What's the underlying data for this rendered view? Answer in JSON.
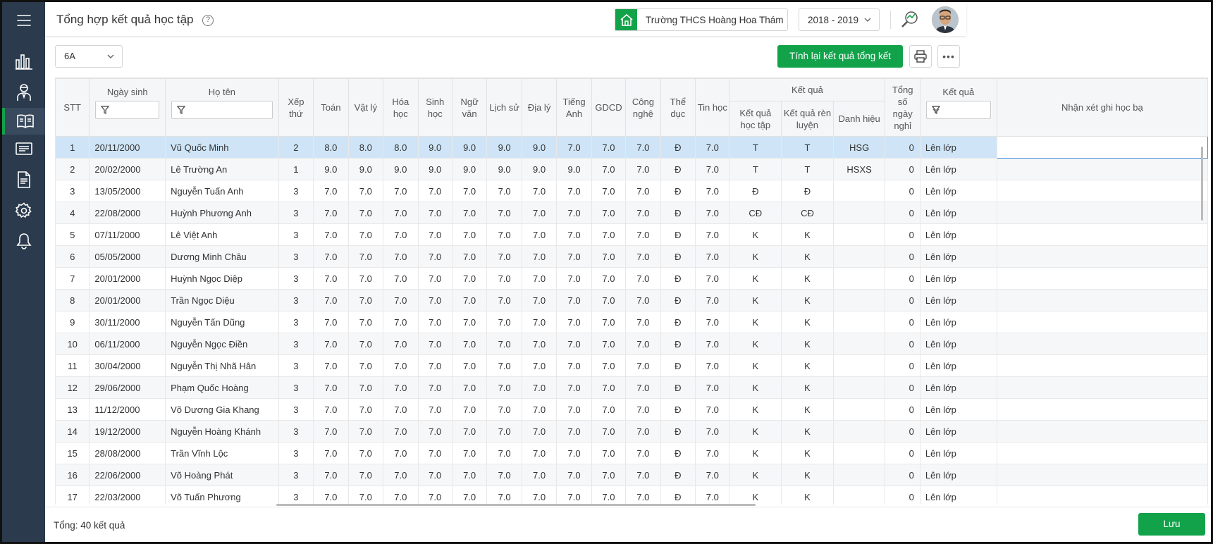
{
  "header": {
    "title": "Tổng hợp kết quả học tập",
    "help_icon": "?",
    "school": "Trường THCS Hoàng Hoa Thám",
    "school_icon": "home-icon",
    "year": "2018 - 2019"
  },
  "sidebar": {
    "items": [
      {
        "name": "menu-icon"
      },
      {
        "name": "bar-chart-icon"
      },
      {
        "name": "teacher-icon"
      },
      {
        "name": "book-icon",
        "active": true
      },
      {
        "name": "id-card-icon"
      },
      {
        "name": "document-icon"
      },
      {
        "name": "gear-icon"
      },
      {
        "name": "bell-icon"
      }
    ]
  },
  "toolbar": {
    "class_value": "6A",
    "recalc_label": "Tính lại kết quả tổng kết",
    "more_label": "•••"
  },
  "table": {
    "headers": {
      "stt": "STT",
      "ngay_sinh": "Ngày sinh",
      "ho_ten": "Họ tên",
      "xep_thu": "Xếp thứ",
      "toan": "Toán",
      "vat_ly": "Vật lý",
      "hoa_hoc": "Hóa học",
      "sinh_hoc": "Sinh học",
      "ngu_van": "Ngữ văn",
      "lich_su": "Lịch sử",
      "dia_ly": "Địa lý",
      "tieng_anh": "Tiếng Anh",
      "gdcd": "GDCD",
      "cong_nghe": "Công nghệ",
      "the_duc": "Thể dục",
      "tin_hoc": "Tin học",
      "ket_qua_group": "Kết quả",
      "kq_hoc_tap": "Kết quả học tập",
      "kq_ren_luyen": "Kết quả rèn luyện",
      "danh_hieu": "Danh hiệu",
      "tong_so_ngay_nghi": "Tổng số ngày nghỉ",
      "ket_qua": "Kết quả",
      "nhan_xet": "Nhận xét ghi học bạ"
    },
    "rows": [
      [
        "1",
        "20/11/2000",
        "Vũ Quốc Minh",
        "2",
        "8.0",
        "8.0",
        "8.0",
        "9.0",
        "9.0",
        "9.0",
        "9.0",
        "7.0",
        "7.0",
        "7.0",
        "Đ",
        "7.0",
        "T",
        "T",
        "HSG",
        "0",
        "Lên lớp"
      ],
      [
        "2",
        "20/02/2000",
        "Lê Trường An",
        "1",
        "9.0",
        "9.0",
        "9.0",
        "9.0",
        "9.0",
        "9.0",
        "9.0",
        "9.0",
        "7.0",
        "7.0",
        "Đ",
        "7.0",
        "T",
        "T",
        "HSXS",
        "0",
        "Lên lớp"
      ],
      [
        "3",
        "13/05/2000",
        "Nguyễn Tuấn Anh",
        "3",
        "7.0",
        "7.0",
        "7.0",
        "7.0",
        "7.0",
        "7.0",
        "7.0",
        "7.0",
        "7.0",
        "7.0",
        "Đ",
        "7.0",
        "Đ",
        "Đ",
        "",
        "0",
        "Lên lớp"
      ],
      [
        "4",
        "22/08/2000",
        "Huỳnh Phương Anh",
        "3",
        "7.0",
        "7.0",
        "7.0",
        "7.0",
        "7.0",
        "7.0",
        "7.0",
        "7.0",
        "7.0",
        "7.0",
        "Đ",
        "7.0",
        "CĐ",
        "CĐ",
        "",
        "0",
        "Lên lớp"
      ],
      [
        "5",
        "07/11/2000",
        "Lê Việt Anh",
        "3",
        "7.0",
        "7.0",
        "7.0",
        "7.0",
        "7.0",
        "7.0",
        "7.0",
        "7.0",
        "7.0",
        "7.0",
        "Đ",
        "7.0",
        "K",
        "K",
        "",
        "0",
        "Lên lớp"
      ],
      [
        "6",
        "05/05/2000",
        "Dương Minh Châu",
        "3",
        "7.0",
        "7.0",
        "7.0",
        "7.0",
        "7.0",
        "7.0",
        "7.0",
        "7.0",
        "7.0",
        "7.0",
        "Đ",
        "7.0",
        "K",
        "K",
        "",
        "0",
        "Lên lớp"
      ],
      [
        "7",
        "20/01/2000",
        "Huỳnh Ngọc Diệp",
        "3",
        "7.0",
        "7.0",
        "7.0",
        "7.0",
        "7.0",
        "7.0",
        "7.0",
        "7.0",
        "7.0",
        "7.0",
        "Đ",
        "7.0",
        "K",
        "K",
        "",
        "0",
        "Lên lớp"
      ],
      [
        "8",
        "20/01/2000",
        "Trần Ngọc Diệu",
        "3",
        "7.0",
        "7.0",
        "7.0",
        "7.0",
        "7.0",
        "7.0",
        "7.0",
        "7.0",
        "7.0",
        "7.0",
        "Đ",
        "7.0",
        "K",
        "K",
        "",
        "0",
        "Lên lớp"
      ],
      [
        "9",
        "30/11/2000",
        "Nguyễn Tấn Dũng",
        "3",
        "7.0",
        "7.0",
        "7.0",
        "7.0",
        "7.0",
        "7.0",
        "7.0",
        "7.0",
        "7.0",
        "7.0",
        "Đ",
        "7.0",
        "K",
        "K",
        "",
        "0",
        "Lên lớp"
      ],
      [
        "10",
        "06/11/2000",
        "Nguyễn Ngọc Điền",
        "3",
        "7.0",
        "7.0",
        "7.0",
        "7.0",
        "7.0",
        "7.0",
        "7.0",
        "7.0",
        "7.0",
        "7.0",
        "Đ",
        "7.0",
        "K",
        "K",
        "",
        "0",
        "Lên lớp"
      ],
      [
        "11",
        "30/04/2000",
        "Nguyễn Thị Nhã Hân",
        "3",
        "7.0",
        "7.0",
        "7.0",
        "7.0",
        "7.0",
        "7.0",
        "7.0",
        "7.0",
        "7.0",
        "7.0",
        "Đ",
        "7.0",
        "K",
        "K",
        "",
        "0",
        "Lên lớp"
      ],
      [
        "12",
        "29/06/2000",
        "Phạm Quốc Hoàng",
        "3",
        "7.0",
        "7.0",
        "7.0",
        "7.0",
        "7.0",
        "7.0",
        "7.0",
        "7.0",
        "7.0",
        "7.0",
        "Đ",
        "7.0",
        "K",
        "K",
        "",
        "0",
        "Lên lớp"
      ],
      [
        "13",
        "11/12/2000",
        "Võ Dương Gia Khang",
        "3",
        "7.0",
        "7.0",
        "7.0",
        "7.0",
        "7.0",
        "7.0",
        "7.0",
        "7.0",
        "7.0",
        "7.0",
        "Đ",
        "7.0",
        "K",
        "K",
        "",
        "0",
        "Lên lớp"
      ],
      [
        "14",
        "19/12/2000",
        "Nguyễn Hoàng Khánh",
        "3",
        "7.0",
        "7.0",
        "7.0",
        "7.0",
        "7.0",
        "7.0",
        "7.0",
        "7.0",
        "7.0",
        "7.0",
        "Đ",
        "7.0",
        "K",
        "K",
        "",
        "0",
        "Lên lớp"
      ],
      [
        "15",
        "28/08/2000",
        "Trần Vĩnh Lộc",
        "3",
        "7.0",
        "7.0",
        "7.0",
        "7.0",
        "7.0",
        "7.0",
        "7.0",
        "7.0",
        "7.0",
        "7.0",
        "Đ",
        "7.0",
        "K",
        "K",
        "",
        "0",
        "Lên lớp"
      ],
      [
        "16",
        "22/06/2000",
        "Võ Hoàng Phát",
        "3",
        "7.0",
        "7.0",
        "7.0",
        "7.0",
        "7.0",
        "7.0",
        "7.0",
        "7.0",
        "7.0",
        "7.0",
        "Đ",
        "7.0",
        "K",
        "K",
        "",
        "0",
        "Lên lớp"
      ],
      [
        "17",
        "22/03/2000",
        "Võ Tuấn Phương",
        "3",
        "7.0",
        "7.0",
        "7.0",
        "7.0",
        "7.0",
        "7.0",
        "7.0",
        "7.0",
        "7.0",
        "7.0",
        "Đ",
        "7.0",
        "K",
        "K",
        "",
        "0",
        "Lên lớp"
      ]
    ]
  },
  "footer": {
    "total": "Tổng: 40 kết quả",
    "save_label": "Lưu"
  }
}
